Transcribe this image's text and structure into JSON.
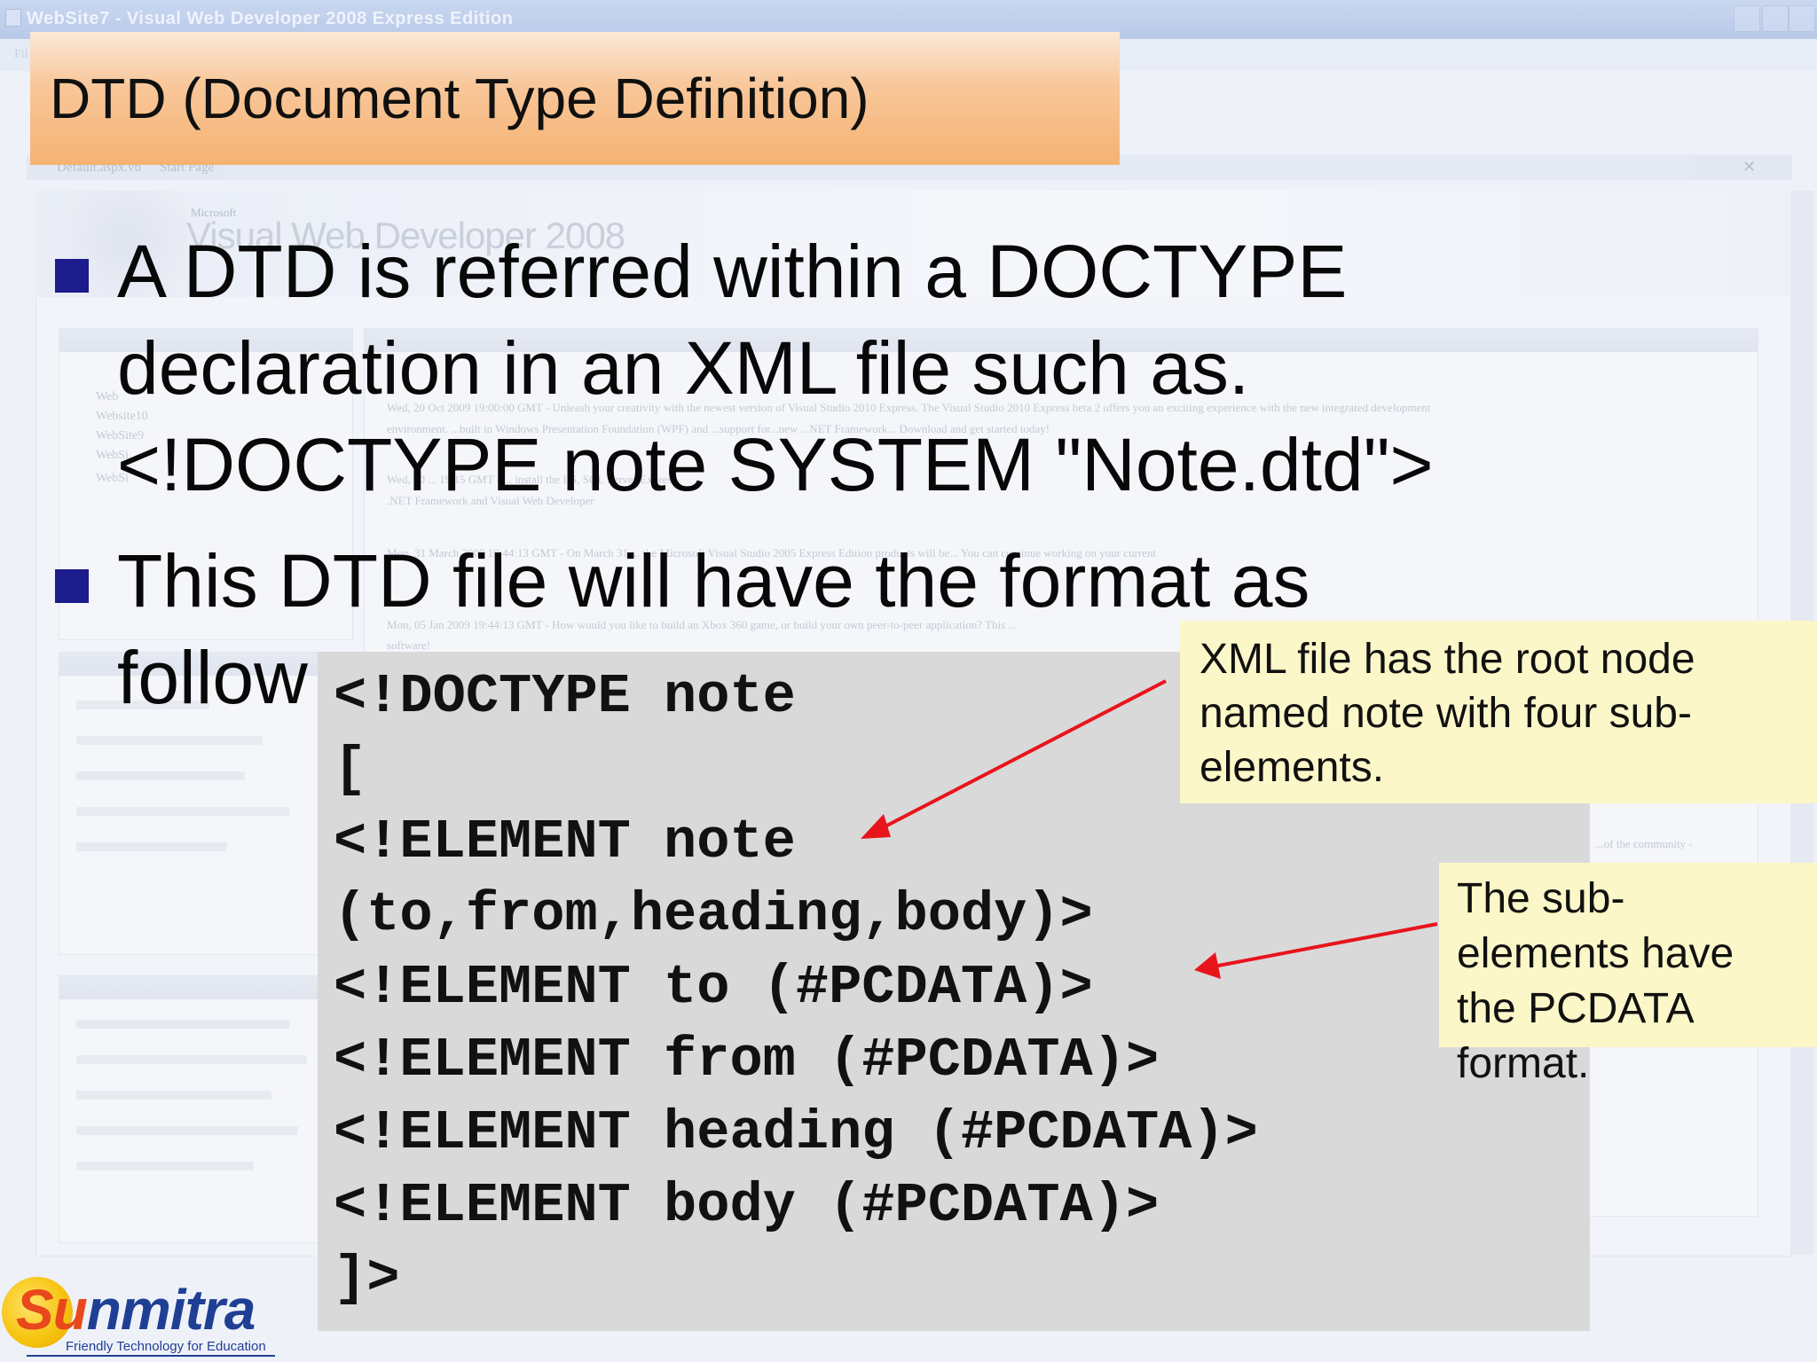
{
  "window": {
    "title": "WebSite7 - Visual Web Developer 2008 Express Edition",
    "menu_fragment": "Fil"
  },
  "ide": {
    "tabs": [
      "Default.aspx.vb",
      "Start Page"
    ],
    "banner_small": "Microsoft",
    "banner_title": "Visual Web Developer 2008",
    "recent_projects": [
      "Web",
      "Website10",
      "WebSite9",
      "WebSi",
      "WebSi"
    ],
    "news_fragments": [
      "Wed, 20 Oct 2009 19:00:00 GMT - Unleash your creativity with the newest version of Visual Studio 2010 Express. The Visual Studio 2010 Express beta 2 offers you an exciting experience with the new integrated development",
      "environment. ...built in Windows Presentation Foundation (WPF) and ...support for...new ...NET Framework... Download and get started today!",
      "Wed, 20 ... 19 15 GMT - ... install the IIS, SQL Server Express,",
      ".NET Framework and Visual Web Developer",
      "Mon, 31 March 2009 19:44:13 GMT - On March 31 ... the Microsoft Visual Studio 2005 Express Edition products will be... You can continue working on your current",
      "Mon, 05 Jan 2009 19:44:13 GMT - How would you like to build an Xbox 360 game, or build your own peer-to-peer application? This ...",
      "software!",
      "...of the community -"
    ]
  },
  "slide": {
    "title": "DTD (Document Type Definition)",
    "bullets": [
      {
        "lines": [
          "A DTD is referred within a DOCTYPE",
          "declaration in an XML file such as.",
          "<!DOCTYPE note SYSTEM \"Note.dtd\">"
        ]
      },
      {
        "lines": [
          "This DTD file will have the format as",
          "follow"
        ]
      }
    ],
    "code_lines": [
      "<!DOCTYPE note",
      "[",
      "<!ELEMENT note",
      "(to,from,heading,body)>",
      "<!ELEMENT to (#PCDATA)>",
      "<!ELEMENT from (#PCDATA)>",
      "<!ELEMENT heading (#PCDATA)>",
      "<!ELEMENT body (#PCDATA)>",
      "]>"
    ],
    "callout_1": {
      "lines": [
        "XML file has the root node",
        "named note with four sub-",
        "elements."
      ]
    },
    "callout_2": {
      "lines": [
        "The sub-",
        "elements have",
        "the PCDATA",
        "format."
      ]
    }
  },
  "logo": {
    "name_part1": "Su",
    "name_part2": "nmitra",
    "tagline": "Friendly Technology for Education"
  },
  "colors": {
    "title_bar": "#f6b273",
    "bullet": "#1c1c8c",
    "code_bg": "#d9d9d9",
    "callout_bg": "#fbf7c8",
    "arrow": "#e8141c",
    "logo_orange": "#e8481c",
    "logo_blue": "#1f3f95",
    "logo_sun": "#f7c512"
  }
}
